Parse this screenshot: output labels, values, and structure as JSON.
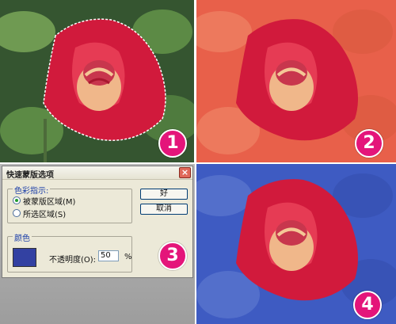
{
  "badges": {
    "b1": "1",
    "b2": "2",
    "b3": "3",
    "b4": "4"
  },
  "dialog": {
    "title": "快速蒙版选项",
    "close_icon": "close-icon",
    "color_indicates": {
      "legend": "色彩指示:",
      "options": [
        {
          "label": "被蒙版区域(M)",
          "checked": true
        },
        {
          "label": "所选区域(S)",
          "checked": false
        }
      ]
    },
    "color": {
      "legend": "颜色",
      "swatch_color": "#3341a2",
      "opacity_label": "不透明度(O):",
      "opacity_value": "50",
      "opacity_unit": "%"
    },
    "buttons": {
      "ok": "好",
      "cancel": "取消"
    }
  },
  "colors": {
    "rose_red": "#d11a3c",
    "leaf_green": "#3a6b3a",
    "overlay_red": "#e8604a",
    "overlay_blue": "#3e5bc2",
    "badge": "#e4157a"
  }
}
